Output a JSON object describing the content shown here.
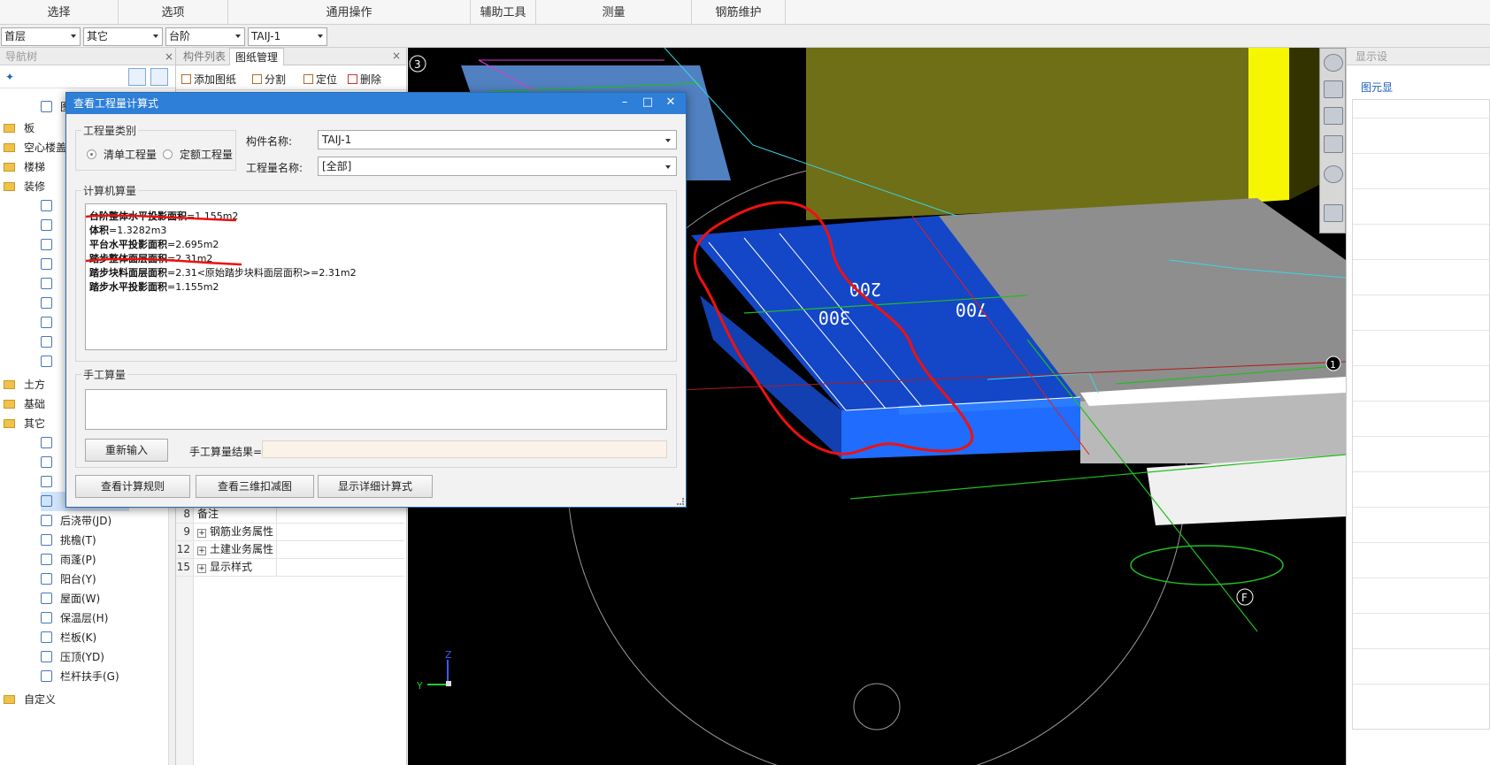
{
  "ribbon": {
    "groups": [
      "选择",
      "选项",
      "通用操作",
      "辅助工具",
      "测量",
      "钢筋维护"
    ]
  },
  "combos": [
    "首层",
    "其它",
    "台阶",
    "TAIJ-1"
  ],
  "nav_panel": {
    "title": "导航树",
    "tree": [
      {
        "label": "板",
        "type": "folder"
      },
      {
        "label": "空心楼盖",
        "type": "folder"
      },
      {
        "label": "楼梯",
        "type": "folder"
      },
      {
        "label": "装修",
        "type": "folder"
      },
      {
        "label": "土方",
        "type": "folder"
      },
      {
        "label": "基础",
        "type": "folder"
      },
      {
        "label": "其它",
        "type": "folder"
      },
      {
        "label": "后浇带(JD)",
        "type": "item"
      },
      {
        "label": "挑檐(T)",
        "type": "item"
      },
      {
        "label": "雨蓬(P)",
        "type": "item"
      },
      {
        "label": "阳台(Y)",
        "type": "item"
      },
      {
        "label": "屋面(W)",
        "type": "item"
      },
      {
        "label": "保温层(H)",
        "type": "item"
      },
      {
        "label": "栏板(K)",
        "type": "item"
      },
      {
        "label": "压顶(YD)",
        "type": "item"
      },
      {
        "label": "栏杆扶手(G)",
        "type": "item"
      },
      {
        "label": "自定义",
        "type": "folder"
      }
    ]
  },
  "component_panel": {
    "tabs": [
      "构件列表",
      "图纸管理"
    ],
    "toolbar": [
      "添加图纸",
      "分割",
      "定位",
      "删除"
    ],
    "property_rows": [
      {
        "num": "8",
        "label": "备注",
        "expand": ""
      },
      {
        "num": "9",
        "label": "钢筋业务属性",
        "expand": "+"
      },
      {
        "num": "12",
        "label": "土建业务属性",
        "expand": "+"
      },
      {
        "num": "15",
        "label": "显示样式",
        "expand": "+"
      }
    ]
  },
  "display_panel": {
    "title": "显示设",
    "tab": "图元显"
  },
  "viewport": {
    "marker_3": "3",
    "marker_f": "F",
    "marker_1": "1",
    "dims": [
      "200",
      "300",
      "700"
    ],
    "axis_z": "Z",
    "axis_y": "Y",
    "colors": {
      "olive": "#7a7a18",
      "blue": "#1446c8",
      "light_blue": "#1f6cff",
      "gray": "#8a8a8a",
      "yellow": "#f4f400",
      "annotation_red": "#e11"
    }
  },
  "dialog": {
    "title": "查看工程量计算式",
    "category_legend": "工程量类别",
    "radio_bill": "清单工程量",
    "radio_quota": "定额工程量",
    "component_name_label": "构件名称:",
    "component_name_value": "TAIJ-1",
    "quantity_name_label": "工程量名称:",
    "quantity_name_value": "[全部]",
    "computer_legend": "计算机算量",
    "formulas": [
      {
        "name": "台阶整体水平投影面积",
        "value": "=1.155m2"
      },
      {
        "name": "体积",
        "value": "=1.3282m3"
      },
      {
        "name": "平台水平投影面积",
        "value": "=2.695m2"
      },
      {
        "name": "踏步整体面层面积",
        "value": "=2.31m2"
      },
      {
        "name": "踏步块料面层面积",
        "value": "=2.31<原始踏步块料面层面积>=2.31m2"
      },
      {
        "name": "踏步水平投影面积",
        "value": "=1.155m2"
      }
    ],
    "manual_legend": "手工算量",
    "reinput_button": "重新输入",
    "manual_result_label": "手工算量结果=",
    "buttons": [
      "查看计算规则",
      "查看三维扣减图",
      "显示详细计算式"
    ]
  }
}
